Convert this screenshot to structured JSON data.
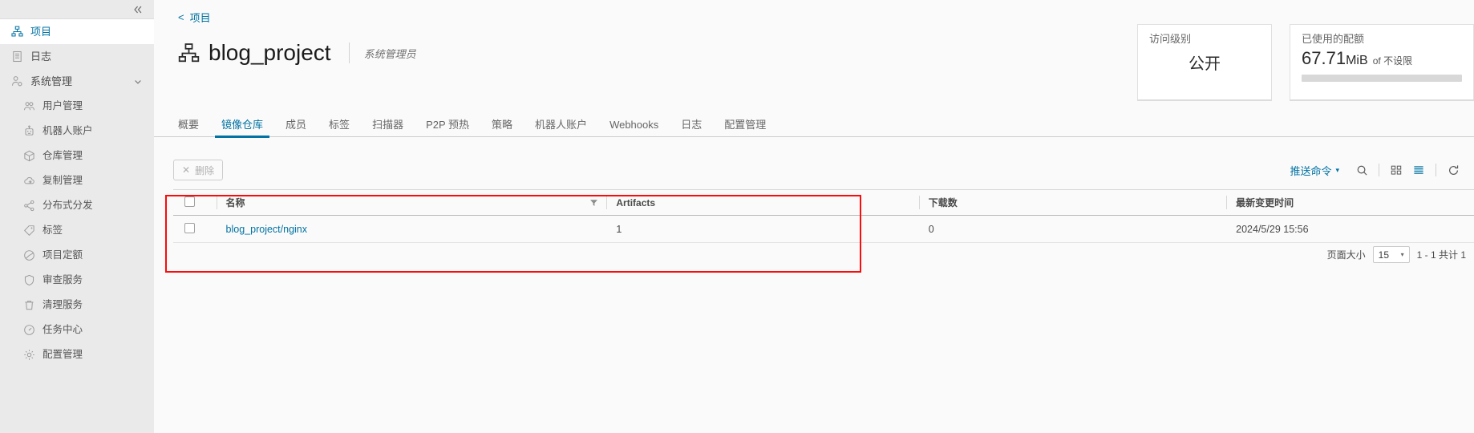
{
  "sidebar": {
    "collapse_icon": "double-chevron-left-icon",
    "items": [
      {
        "label": "项目",
        "icon": "project-hierarchy-icon",
        "active": true,
        "sub": false,
        "chevron": false
      },
      {
        "label": "日志",
        "icon": "logs-list-icon",
        "active": false,
        "sub": false,
        "chevron": false
      },
      {
        "label": "系统管理",
        "icon": "administration-user-icon",
        "active": false,
        "sub": false,
        "chevron": true
      },
      {
        "label": "用户管理",
        "icon": "users-icon",
        "active": false,
        "sub": true,
        "chevron": false
      },
      {
        "label": "机器人账户",
        "icon": "robot-icon",
        "active": false,
        "sub": true,
        "chevron": false
      },
      {
        "label": "仓库管理",
        "icon": "cube-registry-icon",
        "active": false,
        "sub": true,
        "chevron": false
      },
      {
        "label": "复制管理",
        "icon": "cloud-sync-icon",
        "active": false,
        "sub": true,
        "chevron": false
      },
      {
        "label": "分布式分发",
        "icon": "share-nodes-icon",
        "active": false,
        "sub": true,
        "chevron": false
      },
      {
        "label": "标签",
        "icon": "tag-icon",
        "active": false,
        "sub": true,
        "chevron": false
      },
      {
        "label": "项目定额",
        "icon": "pie-chart-icon",
        "active": false,
        "sub": true,
        "chevron": false
      },
      {
        "label": "审查服务",
        "icon": "shield-icon",
        "active": false,
        "sub": true,
        "chevron": false
      },
      {
        "label": "清理服务",
        "icon": "trash-icon",
        "active": false,
        "sub": true,
        "chevron": false
      },
      {
        "label": "任务中心",
        "icon": "gauge-icon",
        "active": false,
        "sub": true,
        "chevron": false
      },
      {
        "label": "配置管理",
        "icon": "gear-icon",
        "active": false,
        "sub": true,
        "chevron": false
      }
    ]
  },
  "breadcrumb": {
    "back_icon": "chevron-left-icon",
    "label": "项目"
  },
  "header": {
    "icon": "project-hierarchy-icon",
    "title": "blog_project",
    "role": "系统管理员"
  },
  "cards": [
    {
      "title": "访问级别",
      "value": "公开"
    },
    {
      "title": "已使用的配额",
      "value": "67.71",
      "unit": "MiB",
      "of_text": "of 不设限"
    }
  ],
  "tabs": [
    {
      "label": "概要",
      "active": false
    },
    {
      "label": "镜像仓库",
      "active": true
    },
    {
      "label": "成员",
      "active": false
    },
    {
      "label": "标签",
      "active": false
    },
    {
      "label": "扫描器",
      "active": false
    },
    {
      "label": "P2P 预热",
      "active": false
    },
    {
      "label": "策略",
      "active": false
    },
    {
      "label": "机器人账户",
      "active": false
    },
    {
      "label": "Webhooks",
      "active": false
    },
    {
      "label": "日志",
      "active": false
    },
    {
      "label": "配置管理",
      "active": false
    }
  ],
  "toolbar": {
    "delete_label": "删除",
    "delete_icon": "close-x-icon",
    "push_command_label": "推送命令",
    "push_command_caret": "chevron-down-icon",
    "search_icon": "search-icon",
    "grid_view_icon": "grid-view-icon",
    "list_view_icon": "list-view-icon",
    "refresh_icon": "refresh-icon"
  },
  "table": {
    "columns": [
      {
        "label": "名称",
        "filter": true
      },
      {
        "label": "Artifacts",
        "filter": false
      },
      {
        "label": "下载数",
        "filter": false
      },
      {
        "label": "最新变更时间",
        "filter": false
      }
    ],
    "rows": [
      {
        "name": "blog_project/nginx",
        "artifacts": "1",
        "downloads": "0",
        "updated": "2024/5/29 15:56"
      }
    ]
  },
  "pagination": {
    "page_size_label": "页面大小",
    "page_size_value": "15",
    "page_size_caret": "chevron-down-icon",
    "range_text": "1 - 1 共计 1"
  },
  "annotation": {
    "color": "#fb0b0b"
  }
}
